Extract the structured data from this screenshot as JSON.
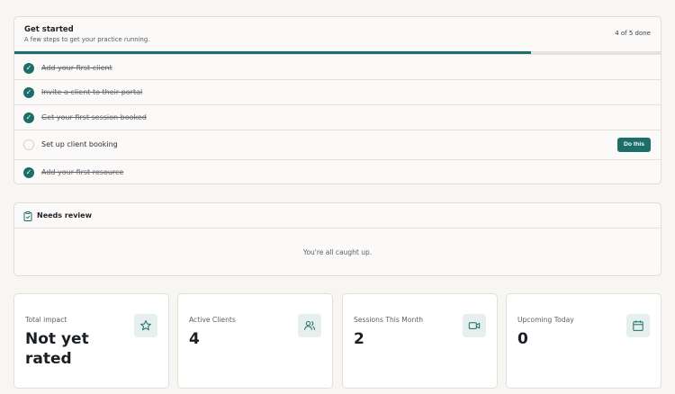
{
  "get_started": {
    "title": "Get started",
    "subtitle": "A few steps to get your practice running.",
    "progress_text": "4 of 5 done",
    "progress_fraction": 0.8,
    "steps": [
      {
        "label": "Add your first client",
        "done": true
      },
      {
        "label": "Invite a client to their portal",
        "done": true
      },
      {
        "label": "Get your first session booked",
        "done": true
      },
      {
        "label": "Set up client booking",
        "done": false,
        "action_label": "Do this"
      },
      {
        "label": "Add your first resource",
        "done": true
      }
    ]
  },
  "needs_review": {
    "title": "Needs review",
    "empty_text": "You're all caught up."
  },
  "stats": [
    {
      "label": "Total impact",
      "value": "Not yet rated",
      "icon": "star-icon"
    },
    {
      "label": "Active Clients",
      "value": "4",
      "icon": "users-icon"
    },
    {
      "label": "Sessions This Month",
      "value": "2",
      "icon": "video-icon"
    },
    {
      "label": "Upcoming Today",
      "value": "0",
      "icon": "calendar-icon"
    }
  ],
  "colors": {
    "accent": "#1c6e68",
    "background": "#f8f6f3",
    "icon_bg": "#e5efed"
  }
}
